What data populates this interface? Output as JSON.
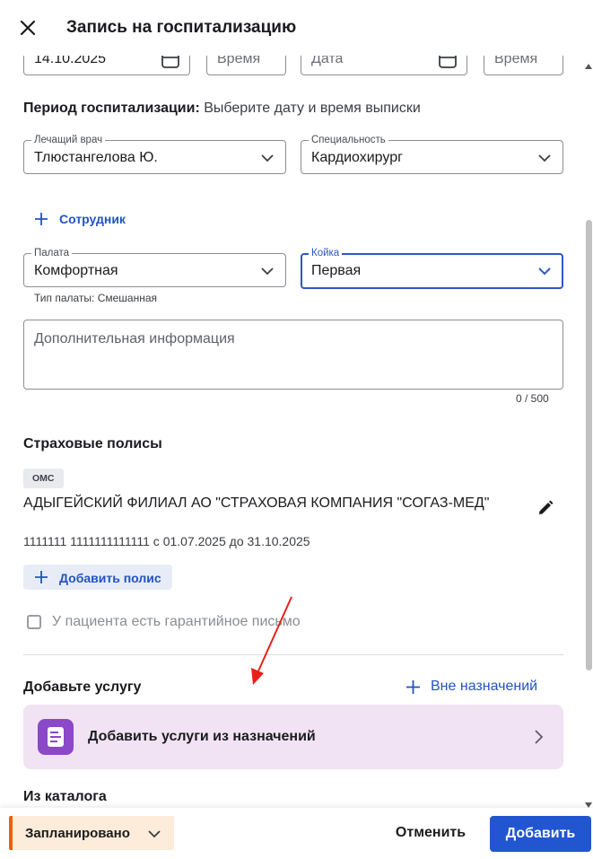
{
  "dialog": {
    "title": "Запись на госпитализацию"
  },
  "admission": {
    "date_value": "14.10.2025",
    "time_placeholder": "Время",
    "discharge_date_placeholder": "Дата",
    "discharge_time_placeholder": "Время"
  },
  "period": {
    "label": "Период госпитализации:",
    "text": "Выберите дату и время выписки"
  },
  "doctor": {
    "label": "Лечащий врач",
    "value": "Тлюстангелова Ю."
  },
  "specialty": {
    "label": "Специальность",
    "value": "Кардиохирург"
  },
  "add_employee": {
    "label": "Сотрудник"
  },
  "ward": {
    "label": "Палата",
    "value": "Комфортная",
    "hint": "Тип палаты: Смешанная"
  },
  "bed": {
    "label": "Койка",
    "value": "Первая"
  },
  "additional_info": {
    "placeholder": "Дополнительная информация",
    "counter": "0 / 500"
  },
  "insurance": {
    "section_title": "Страховые полисы",
    "policy": {
      "type": "ОМС",
      "company": "АДЫГЕЙСКИЙ ФИЛИАЛ АО \"СТРАХОВАЯ КОМПАНИЯ \"СОГАЗ-МЕД\"",
      "details": "1111111 1111111111111 с 01.07.2025 до 31.10.2025"
    },
    "add_policy_label": "Добавить полис"
  },
  "guarantee": {
    "label": "У пациента есть гарантийное письмо",
    "checked": false
  },
  "services": {
    "section_title": "Добавьте услугу",
    "outside_label": "Вне назначений",
    "from_prescriptions_label": "Добавить услуги из назначений",
    "catalog_title": "Из каталога"
  },
  "footer": {
    "status": "Запланировано",
    "cancel_label": "Отменить",
    "add_label": "Добавить"
  },
  "colors": {
    "accent": "#2156d0",
    "service_card_bg": "#f1e3f3",
    "service_icon_bg": "#8b48c9",
    "status_bg": "#fcecd9",
    "status_border": "#e8620f",
    "annotation_arrow": "#e8201a"
  },
  "icons": {
    "close": "close-icon",
    "calendar": "calendar-icon",
    "chevron": "chevron-down-icon",
    "plus": "plus-icon",
    "edit": "pencil-icon",
    "document": "document-icon",
    "chevron_right": "chevron-right-icon"
  }
}
